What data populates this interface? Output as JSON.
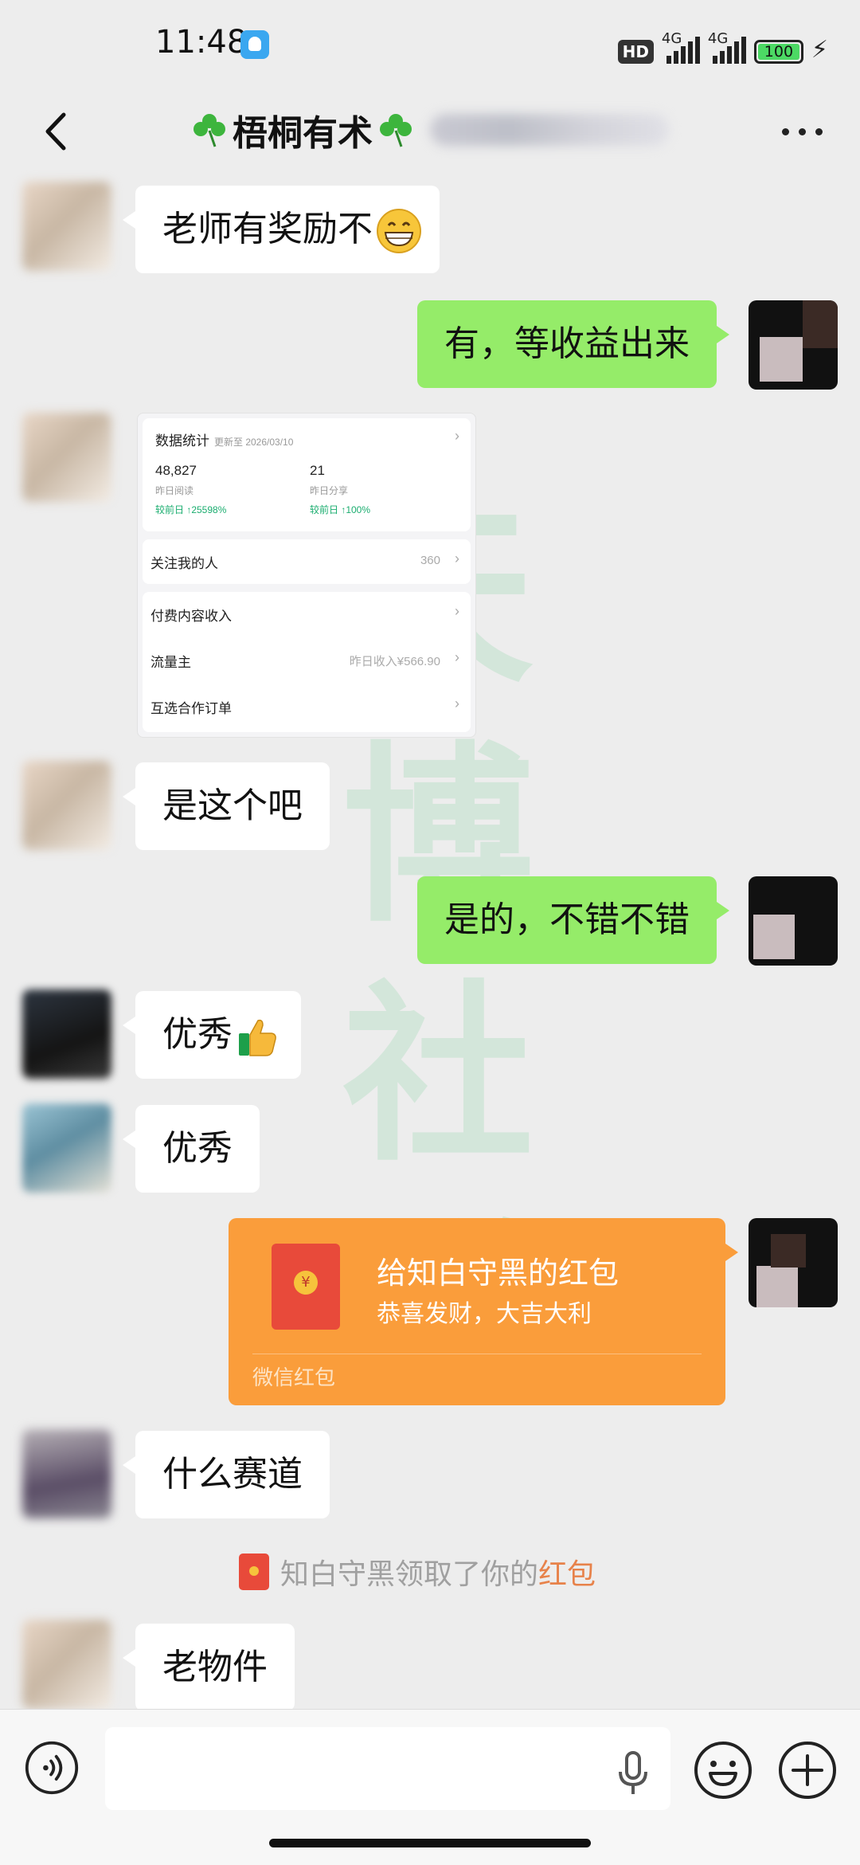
{
  "status_bar": {
    "time": "11:48",
    "hd_label": "HD",
    "net_1": "4G",
    "net_2": "4G",
    "battery": "100"
  },
  "header": {
    "back_icon": "chevron-left-icon",
    "title": "梧桐有术",
    "more_icon": "more-horizontal-icon"
  },
  "messages": [
    {
      "side": "left",
      "text": "老师有奖励不",
      "emoji": "grinning-face"
    },
    {
      "side": "right",
      "text": "有，等收益出来"
    },
    {
      "side": "left",
      "type": "image"
    },
    {
      "side": "left",
      "text": "是这个吧"
    },
    {
      "side": "right",
      "text": "是的，不错不错"
    },
    {
      "side": "left",
      "text": "优秀",
      "emoji": "thumbs-up"
    },
    {
      "side": "left",
      "text": "优秀"
    },
    {
      "side": "right",
      "type": "red_packet"
    },
    {
      "side": "left",
      "text": "什么赛道"
    },
    {
      "side": "left",
      "text": "老物件"
    }
  ],
  "image_card": {
    "title": "数据统计",
    "updated": "更新至 2026/03/10",
    "stat1_value": "48,827",
    "stat1_label": "昨日阅读",
    "stat1_change": "较前日 ↑25598%",
    "stat2_value": "21",
    "stat2_label": "昨日分享",
    "stat2_change": "较前日 ↑100%",
    "row1_label": "关注我的人",
    "row1_value": "360",
    "row2_label": "付费内容收入",
    "row3_label": "流量主",
    "row3_value": "昨日收入¥566.90",
    "row4_label": "互选合作订单"
  },
  "red_packet": {
    "title": "给知白守黑的红包",
    "subtitle": "恭喜发财，大吉大利",
    "footer": "微信红包"
  },
  "system_message": {
    "prefix": "知白守黑领取了你的",
    "link": "红包"
  },
  "watermark": "天博社群",
  "colors": {
    "background": "#ededed",
    "bubble_self": "#95ec69",
    "bubble_other": "#ffffff",
    "red_packet": "#fa9d3b"
  },
  "input_bar": {
    "voice_icon": "voice-icon",
    "mic_icon": "mic-icon",
    "emoji_icon": "emoji-icon",
    "plus_icon": "plus-icon"
  }
}
